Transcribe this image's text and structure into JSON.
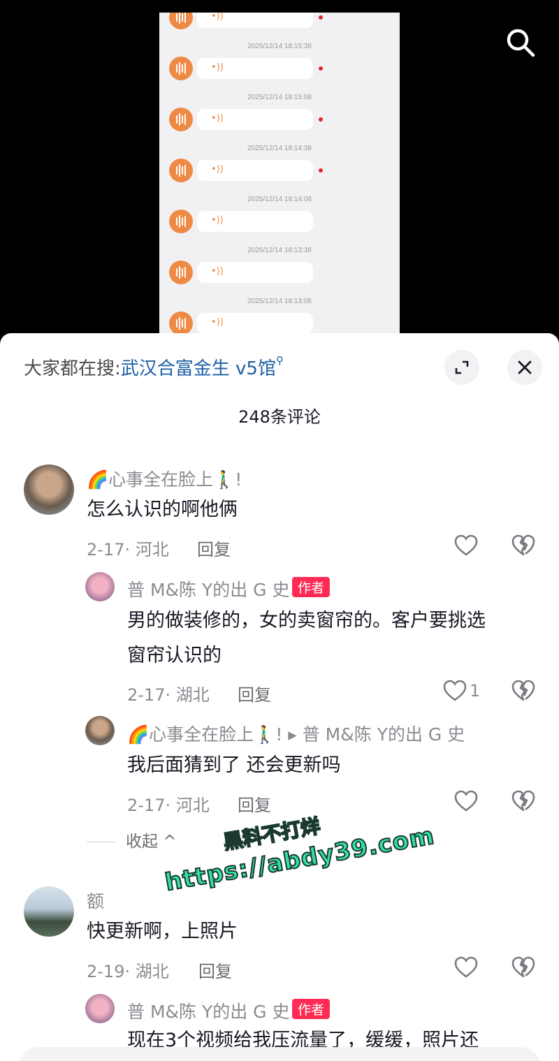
{
  "video": {
    "voice_messages": [
      {
        "timestamp": "",
        "unread": true
      },
      {
        "timestamp": "2025/12/14 18:15:38",
        "unread": true
      },
      {
        "timestamp": "2025/12/14 18:15:08",
        "unread": true
      },
      {
        "timestamp": "2025/12/14 18:14:38",
        "unread": true
      },
      {
        "timestamp": "2025/12/14 18:14:08",
        "unread": false
      },
      {
        "timestamp": "2025/12/14 18:13:38",
        "unread": false
      },
      {
        "timestamp": "2025/12/14 18:13:08",
        "unread": false
      }
    ],
    "search_icon": "search-icon"
  },
  "trend": {
    "label": "大家都在搜:",
    "keyword": "武汉合富金生 v5馆"
  },
  "panel": {
    "comment_count": "248条评论",
    "expand_icon": "expand-icon",
    "close_icon": "close-icon"
  },
  "comments": [
    {
      "user": "🌈心事全在脸上🚶‍♂️!",
      "text": "怎么认识的啊他俩",
      "date": "2-17· 河北",
      "reply_label": "回复",
      "likes": ""
    },
    {
      "user": "普 M&陈 Y的出 G 史",
      "author_tag": "作者",
      "text_line1": "男的做装修的，女的卖窗帘的。客户要挑选",
      "text_line2": "窗帘认识的",
      "date": "2-17· 湖北",
      "reply_label": "回复",
      "likes": "1"
    },
    {
      "user": "🌈心事全在脸上🚶‍♂️! ▸ 普 M&陈 Y的出 G 史",
      "text": "我后面猜到了 还会更新吗",
      "date": "2-17· 河北",
      "reply_label": "回复",
      "likes": ""
    },
    {
      "user": "额",
      "text": "快更新啊，上照片",
      "date": "2-19· 湖北",
      "reply_label": "回复",
      "likes": ""
    },
    {
      "user": "普 M&陈 Y的出 G 史",
      "author_tag": "作者",
      "text": "现在3个视频给我压流量了，缓缓，照片还"
    }
  ],
  "collapse_label": "收起 ^",
  "watermark": {
    "line1": "黑料不打烊",
    "line2": "https://abdy39.com"
  },
  "colors": {
    "accent_red": "#fe2c55",
    "link_blue": "#1d5fa5",
    "voice_orange": "#ef8a45"
  }
}
